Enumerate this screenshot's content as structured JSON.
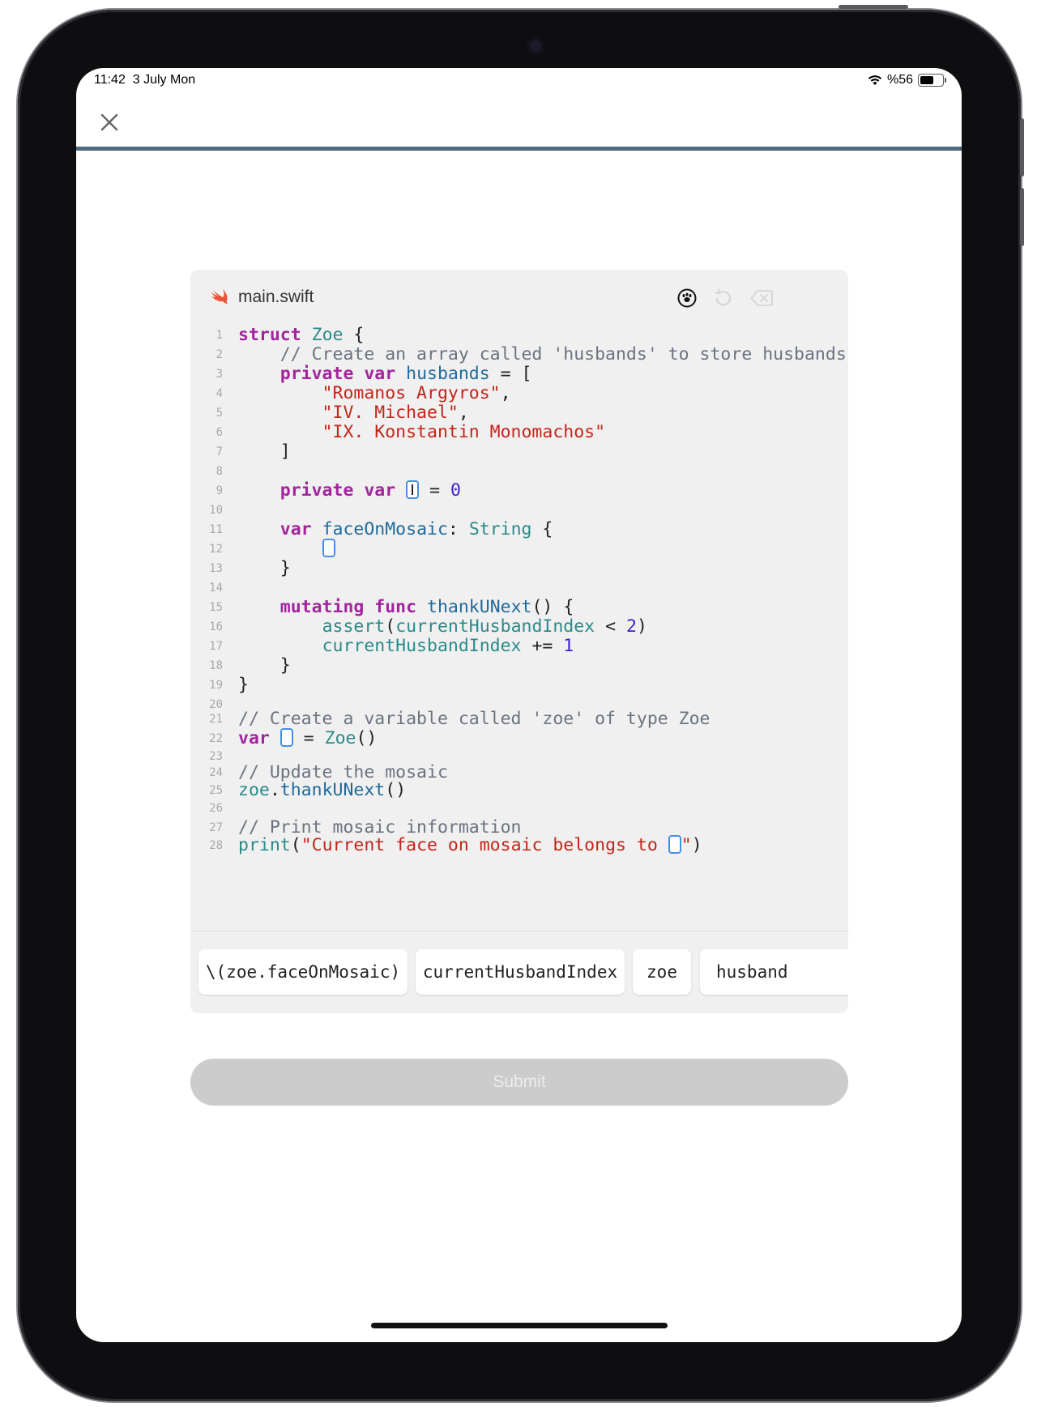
{
  "status": {
    "time": "11:42",
    "date": "3 July Mon",
    "battery_text": "%56"
  },
  "editor": {
    "filename": "main.swift"
  },
  "code_lines": [
    {
      "n": "1",
      "parts": [
        [
          "kw",
          "struct"
        ],
        [
          "pl",
          " "
        ],
        [
          "ty",
          "Zoe"
        ],
        [
          "pl",
          " {"
        ]
      ]
    },
    {
      "n": "2",
      "parts": [
        [
          "cm",
          "    // Create an array called 'husbands' to store husbands"
        ]
      ]
    },
    {
      "n": "3",
      "parts": [
        [
          "pl",
          "    "
        ],
        [
          "kw",
          "private"
        ],
        [
          "pl",
          " "
        ],
        [
          "kw",
          "var"
        ],
        [
          "pl",
          " "
        ],
        [
          "fn",
          "husbands"
        ],
        [
          "pl",
          " = ["
        ]
      ]
    },
    {
      "n": "4",
      "parts": [
        [
          "st",
          "        \"Romanos Argyros\""
        ],
        [
          "pl",
          ","
        ]
      ]
    },
    {
      "n": "5",
      "parts": [
        [
          "st",
          "        \"IV. Michael\""
        ],
        [
          "pl",
          ","
        ]
      ]
    },
    {
      "n": "6",
      "parts": [
        [
          "st",
          "        \"IX. Konstantin Monomachos\""
        ]
      ]
    },
    {
      "n": "7",
      "parts": [
        [
          "pl",
          "    ]"
        ]
      ]
    },
    {
      "n": "8",
      "parts": []
    },
    {
      "n": "9",
      "parts": [
        [
          "pl",
          "    "
        ],
        [
          "kw",
          "private"
        ],
        [
          "pl",
          " "
        ],
        [
          "kw",
          "var"
        ],
        [
          "pl",
          " "
        ],
        [
          "slot",
          "active"
        ],
        [
          "pl",
          " = "
        ],
        [
          "nu",
          "0"
        ]
      ]
    },
    {
      "n": "10",
      "parts": []
    },
    {
      "n": "11",
      "parts": [
        [
          "pl",
          "    "
        ],
        [
          "kw",
          "var"
        ],
        [
          "pl",
          " "
        ],
        [
          "fn",
          "faceOnMosaic"
        ],
        [
          "pl",
          ": "
        ],
        [
          "ty",
          "String"
        ],
        [
          "pl",
          " {"
        ]
      ]
    },
    {
      "n": "12",
      "parts": [
        [
          "pl",
          "        "
        ],
        [
          "slot",
          ""
        ]
      ]
    },
    {
      "n": "13",
      "parts": [
        [
          "pl",
          "    }"
        ]
      ]
    },
    {
      "n": "14",
      "parts": []
    },
    {
      "n": "15",
      "parts": [
        [
          "pl",
          "    "
        ],
        [
          "kw",
          "mutating"
        ],
        [
          "pl",
          " "
        ],
        [
          "kw",
          "func"
        ],
        [
          "pl",
          " "
        ],
        [
          "fn",
          "thankUNext"
        ],
        [
          "pl",
          "() {"
        ]
      ]
    },
    {
      "n": "16",
      "parts": [
        [
          "pl",
          "        "
        ],
        [
          "ty",
          "assert"
        ],
        [
          "pl",
          "("
        ],
        [
          "ty",
          "currentHusbandIndex"
        ],
        [
          "pl",
          " < "
        ],
        [
          "nu",
          "2"
        ],
        [
          "pl",
          ")"
        ]
      ]
    },
    {
      "n": "17",
      "parts": [
        [
          "pl",
          "        "
        ],
        [
          "ty",
          "currentHusbandIndex"
        ],
        [
          "pl",
          " += "
        ],
        [
          "nu",
          "1"
        ]
      ]
    },
    {
      "n": "18",
      "parts": [
        [
          "pl",
          "    }"
        ]
      ]
    },
    {
      "n": "19",
      "parts": [
        [
          "pl",
          "}"
        ]
      ]
    },
    {
      "n": "20",
      "parts": []
    },
    {
      "n": "21",
      "parts": [
        [
          "cm",
          "// Create a variable called 'zoe' of type Zoe"
        ]
      ]
    },
    {
      "n": "22",
      "parts": [
        [
          "kw",
          "var"
        ],
        [
          "pl",
          " "
        ],
        [
          "slot",
          ""
        ],
        [
          "pl",
          " = "
        ],
        [
          "ty",
          "Zoe"
        ],
        [
          "pl",
          "()"
        ]
      ]
    },
    {
      "n": "23",
      "parts": []
    },
    {
      "n": "24",
      "parts": [
        [
          "cm",
          "// Update the mosaic"
        ]
      ]
    },
    {
      "n": "25",
      "parts": [
        [
          "ty",
          "zoe"
        ],
        [
          "pl",
          "."
        ],
        [
          "fn",
          "thankUNext"
        ],
        [
          "pl",
          "()"
        ]
      ]
    },
    {
      "n": "26",
      "parts": []
    },
    {
      "n": "27",
      "parts": [
        [
          "cm",
          "// Print mosaic information"
        ]
      ]
    },
    {
      "n": "28",
      "parts": [
        [
          "ty",
          "print"
        ],
        [
          "pl",
          "("
        ],
        [
          "st",
          "\"Current face on mosaic belongs to "
        ],
        [
          "slot",
          ""
        ],
        [
          "st",
          "\""
        ],
        [
          "pl",
          ")"
        ]
      ]
    }
  ],
  "tokens": [
    "\\(zoe.faceOnMosaic)",
    "currentHusbandIndex",
    "zoe",
    "husband"
  ],
  "submit_label": "Submit",
  "colors": {
    "keyword": "#a3249d",
    "type": "#2a8a8a",
    "string": "#c3251a",
    "number": "#3b24d0",
    "comment": "#6b7380",
    "slot_border": "#4a8de6",
    "divider": "#4d6b7c",
    "swift_logo": "#f05138"
  },
  "icons": {
    "close": "close-icon",
    "paw": "paw-icon",
    "undo": "undo-icon",
    "delete": "delete-icon",
    "swift": "swift-logo-icon",
    "wifi": "wifi-icon",
    "battery": "battery-icon"
  }
}
